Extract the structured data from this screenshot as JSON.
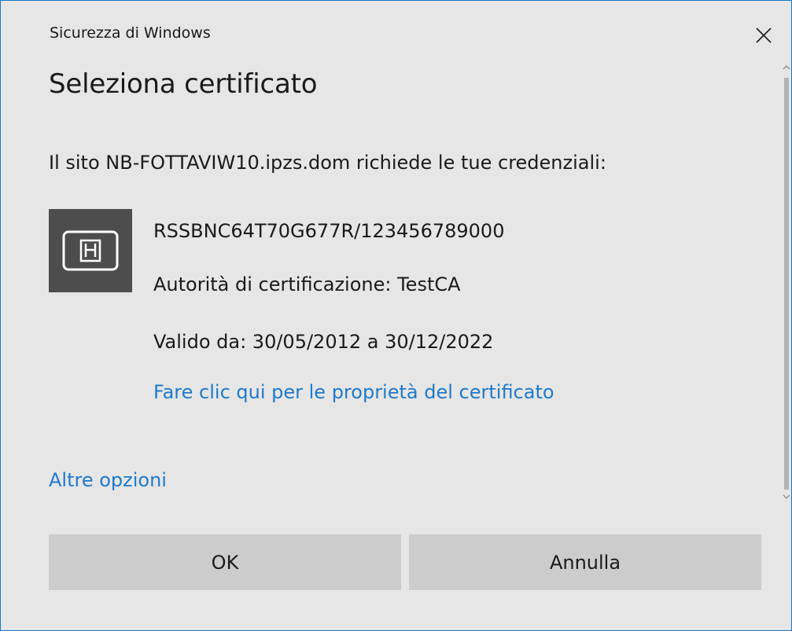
{
  "window": {
    "title": "Sicurezza di Windows"
  },
  "dialog": {
    "heading": "Seleziona certificato",
    "site_message": "Il sito NB-FOTTAVIW10.ipzs.dom richiede le tue credenziali:"
  },
  "certificate": {
    "subject": "RSSBNC64T70G677R/123456789000",
    "issuer": "Autorità di certificazione: TestCA",
    "validity": "Valido da: 30/05/2012 a 30/12/2022",
    "properties_link": "Fare clic qui per le proprietà del certificato",
    "icon": "certificate-card-icon"
  },
  "options": {
    "more_label": "Altre opzioni"
  },
  "buttons": {
    "ok_label": "OK",
    "cancel_label": "Annulla"
  },
  "colors": {
    "accent_link": "#1f7acb",
    "window_border": "#1a73c8",
    "tile_background": "#4d4d4d",
    "button_background": "#cccccc",
    "dialog_background": "#e6e6e6"
  }
}
